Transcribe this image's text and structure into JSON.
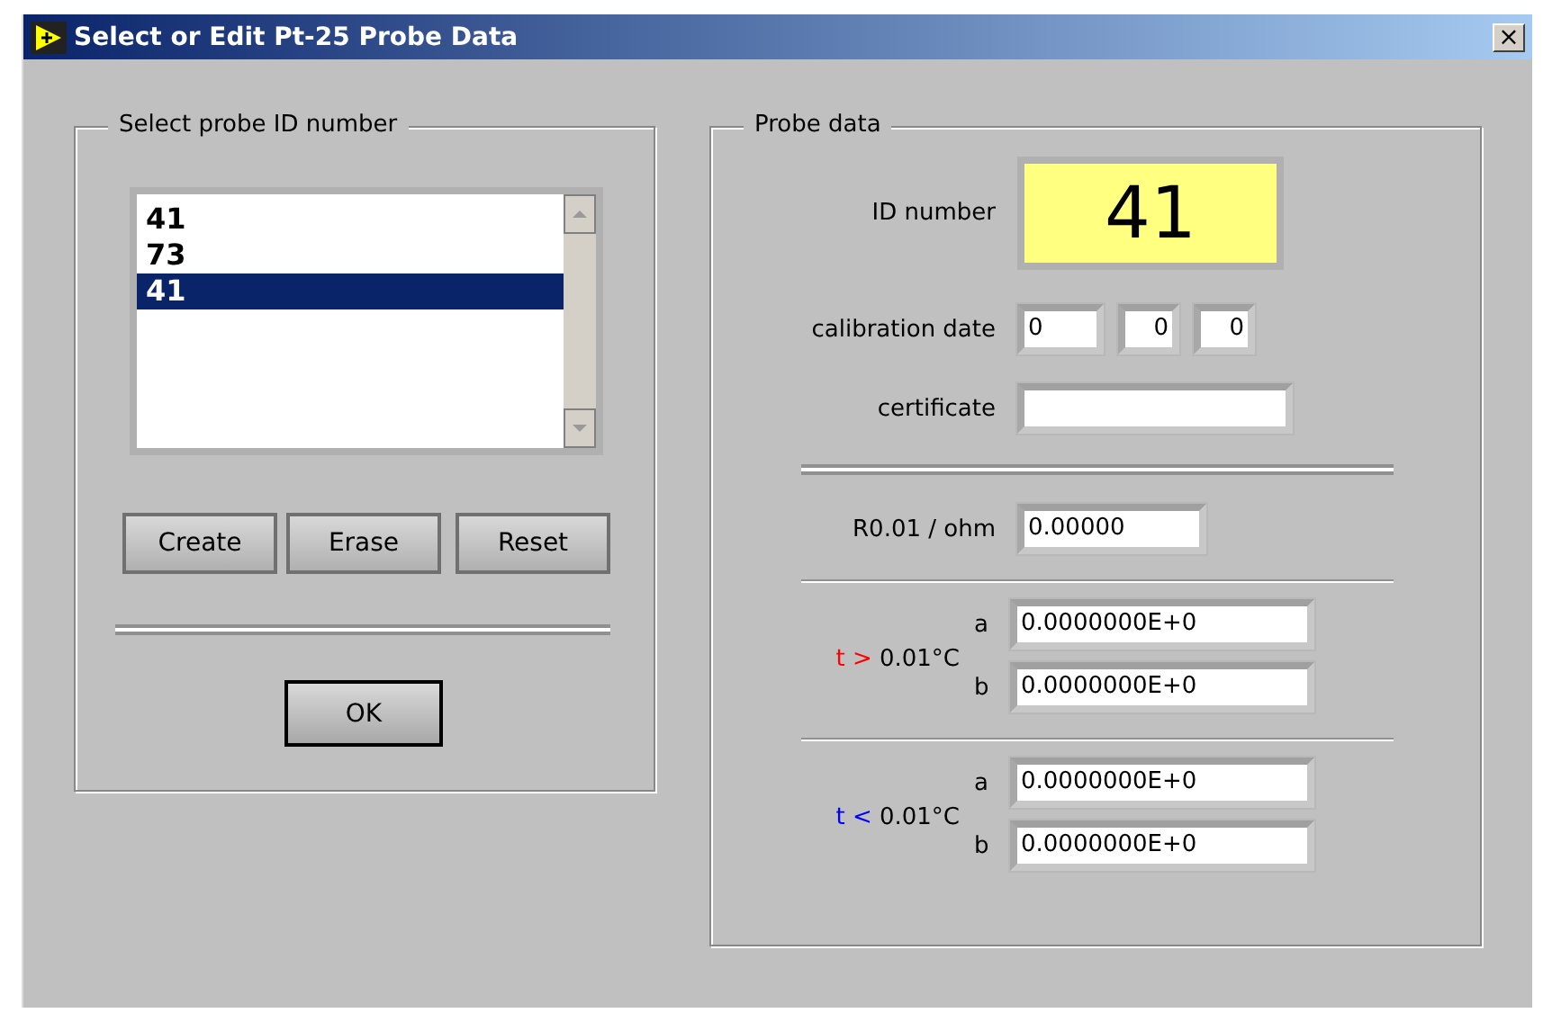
{
  "window": {
    "title": "Select or Edit Pt-25 Probe Data",
    "close": "×"
  },
  "probe_select": {
    "title": "Select probe ID number",
    "list": [
      {
        "label": "41",
        "selected": false
      },
      {
        "label": "73",
        "selected": false
      },
      {
        "label": "41",
        "selected": true
      }
    ],
    "buttons": [
      "Create",
      "Erase",
      "Reset"
    ],
    "ok": "OK"
  },
  "probe_data": {
    "title": "Probe data",
    "id_label": "ID number",
    "id_value": "41",
    "date_label": "calibration date",
    "date_fields": [
      "0",
      "0",
      "0"
    ],
    "certificate_label": "certificate",
    "r_label": "R0.01 / ohm",
    "r_value": "0.00000",
    "coefficients": [
      {
        "sign": "t >",
        "color": "#ff0000",
        "threshold": "0.01°C",
        "rows": [
          {
            "name": "a",
            "value": "0.0000000E+0"
          },
          {
            "name": "b",
            "value": "0.0000000E+0"
          }
        ]
      },
      {
        "sign": "t <",
        "color": "#0000ff",
        "threshold": "0.01°C",
        "rows": [
          {
            "name": "a",
            "value": "0.0000000E+0"
          },
          {
            "name": "b",
            "value": "0.0000000E+0"
          }
        ]
      }
    ]
  }
}
